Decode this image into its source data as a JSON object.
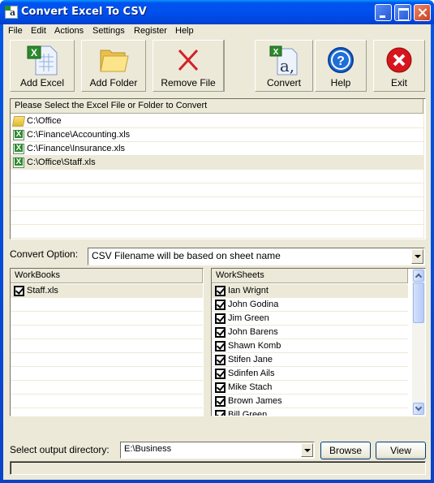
{
  "window": {
    "title": "Convert Excel To CSV",
    "app_icon_glyph": "a"
  },
  "menu": [
    "File",
    "Edit",
    "Actions",
    "Settings",
    "Register",
    "Help"
  ],
  "toolbar": {
    "add_excel": "Add Excel",
    "add_folder": "Add Folder",
    "remove_file": "Remove File",
    "convert": "Convert",
    "help": "Help",
    "exit": "Exit"
  },
  "file_list": {
    "header": "Please Select the Excel File or Folder to Convert",
    "items": [
      {
        "icon": "folder-icon",
        "path": "C:\\Office"
      },
      {
        "icon": "excel-file-icon",
        "path": "C:\\Finance\\Accounting.xls"
      },
      {
        "icon": "excel-file-icon",
        "path": "C:\\Finance\\Insurance.xls"
      },
      {
        "icon": "excel-file-icon",
        "path": "C:\\Office\\Staff.xls",
        "selected": true
      }
    ]
  },
  "convert_option": {
    "label": "Convert Option:",
    "value": "CSV Filename will be based on sheet name"
  },
  "workbooks": {
    "header": "WorkBooks",
    "items": [
      {
        "name": "Staff.xls",
        "checked": true
      }
    ]
  },
  "worksheets": {
    "header": "WorkSheets",
    "items": [
      {
        "name": "Ian Wrignt",
        "checked": true
      },
      {
        "name": "John Godina",
        "checked": true
      },
      {
        "name": "Jim Green",
        "checked": true
      },
      {
        "name": "John Barens",
        "checked": true
      },
      {
        "name": "Shawn Komb",
        "checked": true
      },
      {
        "name": "Stifen Jane",
        "checked": true
      },
      {
        "name": "Sdinfen Ails",
        "checked": true
      },
      {
        "name": "Mike Stach",
        "checked": true
      },
      {
        "name": "Brown James",
        "checked": true
      },
      {
        "name": "Bill Green",
        "checked": true
      }
    ]
  },
  "output": {
    "label": "Select  output directory:",
    "value": "E:\\Business",
    "browse": "Browse",
    "view": "View"
  },
  "status": ""
}
